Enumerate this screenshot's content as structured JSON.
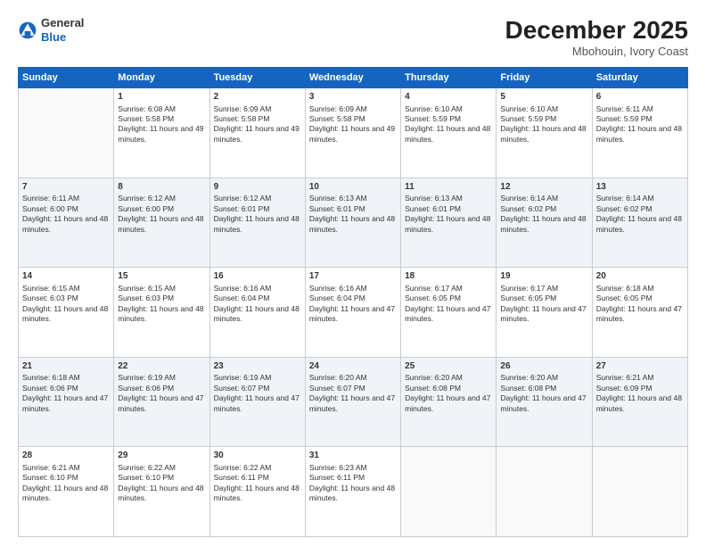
{
  "header": {
    "logo_general": "General",
    "logo_blue": "Blue",
    "month": "December 2025",
    "location": "Mbohouin, Ivory Coast"
  },
  "weekdays": [
    "Sunday",
    "Monday",
    "Tuesday",
    "Wednesday",
    "Thursday",
    "Friday",
    "Saturday"
  ],
  "weeks": [
    [
      {
        "day": "",
        "sunrise": "",
        "sunset": "",
        "daylight": ""
      },
      {
        "day": "1",
        "sunrise": "Sunrise: 6:08 AM",
        "sunset": "Sunset: 5:58 PM",
        "daylight": "Daylight: 11 hours and 49 minutes."
      },
      {
        "day": "2",
        "sunrise": "Sunrise: 6:09 AM",
        "sunset": "Sunset: 5:58 PM",
        "daylight": "Daylight: 11 hours and 49 minutes."
      },
      {
        "day": "3",
        "sunrise": "Sunrise: 6:09 AM",
        "sunset": "Sunset: 5:58 PM",
        "daylight": "Daylight: 11 hours and 49 minutes."
      },
      {
        "day": "4",
        "sunrise": "Sunrise: 6:10 AM",
        "sunset": "Sunset: 5:59 PM",
        "daylight": "Daylight: 11 hours and 48 minutes."
      },
      {
        "day": "5",
        "sunrise": "Sunrise: 6:10 AM",
        "sunset": "Sunset: 5:59 PM",
        "daylight": "Daylight: 11 hours and 48 minutes."
      },
      {
        "day": "6",
        "sunrise": "Sunrise: 6:11 AM",
        "sunset": "Sunset: 5:59 PM",
        "daylight": "Daylight: 11 hours and 48 minutes."
      }
    ],
    [
      {
        "day": "7",
        "sunrise": "Sunrise: 6:11 AM",
        "sunset": "Sunset: 6:00 PM",
        "daylight": "Daylight: 11 hours and 48 minutes."
      },
      {
        "day": "8",
        "sunrise": "Sunrise: 6:12 AM",
        "sunset": "Sunset: 6:00 PM",
        "daylight": "Daylight: 11 hours and 48 minutes."
      },
      {
        "day": "9",
        "sunrise": "Sunrise: 6:12 AM",
        "sunset": "Sunset: 6:01 PM",
        "daylight": "Daylight: 11 hours and 48 minutes."
      },
      {
        "day": "10",
        "sunrise": "Sunrise: 6:13 AM",
        "sunset": "Sunset: 6:01 PM",
        "daylight": "Daylight: 11 hours and 48 minutes."
      },
      {
        "day": "11",
        "sunrise": "Sunrise: 6:13 AM",
        "sunset": "Sunset: 6:01 PM",
        "daylight": "Daylight: 11 hours and 48 minutes."
      },
      {
        "day": "12",
        "sunrise": "Sunrise: 6:14 AM",
        "sunset": "Sunset: 6:02 PM",
        "daylight": "Daylight: 11 hours and 48 minutes."
      },
      {
        "day": "13",
        "sunrise": "Sunrise: 6:14 AM",
        "sunset": "Sunset: 6:02 PM",
        "daylight": "Daylight: 11 hours and 48 minutes."
      }
    ],
    [
      {
        "day": "14",
        "sunrise": "Sunrise: 6:15 AM",
        "sunset": "Sunset: 6:03 PM",
        "daylight": "Daylight: 11 hours and 48 minutes."
      },
      {
        "day": "15",
        "sunrise": "Sunrise: 6:15 AM",
        "sunset": "Sunset: 6:03 PM",
        "daylight": "Daylight: 11 hours and 48 minutes."
      },
      {
        "day": "16",
        "sunrise": "Sunrise: 6:16 AM",
        "sunset": "Sunset: 6:04 PM",
        "daylight": "Daylight: 11 hours and 48 minutes."
      },
      {
        "day": "17",
        "sunrise": "Sunrise: 6:16 AM",
        "sunset": "Sunset: 6:04 PM",
        "daylight": "Daylight: 11 hours and 47 minutes."
      },
      {
        "day": "18",
        "sunrise": "Sunrise: 6:17 AM",
        "sunset": "Sunset: 6:05 PM",
        "daylight": "Daylight: 11 hours and 47 minutes."
      },
      {
        "day": "19",
        "sunrise": "Sunrise: 6:17 AM",
        "sunset": "Sunset: 6:05 PM",
        "daylight": "Daylight: 11 hours and 47 minutes."
      },
      {
        "day": "20",
        "sunrise": "Sunrise: 6:18 AM",
        "sunset": "Sunset: 6:05 PM",
        "daylight": "Daylight: 11 hours and 47 minutes."
      }
    ],
    [
      {
        "day": "21",
        "sunrise": "Sunrise: 6:18 AM",
        "sunset": "Sunset: 6:06 PM",
        "daylight": "Daylight: 11 hours and 47 minutes."
      },
      {
        "day": "22",
        "sunrise": "Sunrise: 6:19 AM",
        "sunset": "Sunset: 6:06 PM",
        "daylight": "Daylight: 11 hours and 47 minutes."
      },
      {
        "day": "23",
        "sunrise": "Sunrise: 6:19 AM",
        "sunset": "Sunset: 6:07 PM",
        "daylight": "Daylight: 11 hours and 47 minutes."
      },
      {
        "day": "24",
        "sunrise": "Sunrise: 6:20 AM",
        "sunset": "Sunset: 6:07 PM",
        "daylight": "Daylight: 11 hours and 47 minutes."
      },
      {
        "day": "25",
        "sunrise": "Sunrise: 6:20 AM",
        "sunset": "Sunset: 6:08 PM",
        "daylight": "Daylight: 11 hours and 47 minutes."
      },
      {
        "day": "26",
        "sunrise": "Sunrise: 6:20 AM",
        "sunset": "Sunset: 6:08 PM",
        "daylight": "Daylight: 11 hours and 47 minutes."
      },
      {
        "day": "27",
        "sunrise": "Sunrise: 6:21 AM",
        "sunset": "Sunset: 6:09 PM",
        "daylight": "Daylight: 11 hours and 48 minutes."
      }
    ],
    [
      {
        "day": "28",
        "sunrise": "Sunrise: 6:21 AM",
        "sunset": "Sunset: 6:10 PM",
        "daylight": "Daylight: 11 hours and 48 minutes."
      },
      {
        "day": "29",
        "sunrise": "Sunrise: 6:22 AM",
        "sunset": "Sunset: 6:10 PM",
        "daylight": "Daylight: 11 hours and 48 minutes."
      },
      {
        "day": "30",
        "sunrise": "Sunrise: 6:22 AM",
        "sunset": "Sunset: 6:11 PM",
        "daylight": "Daylight: 11 hours and 48 minutes."
      },
      {
        "day": "31",
        "sunrise": "Sunrise: 6:23 AM",
        "sunset": "Sunset: 6:11 PM",
        "daylight": "Daylight: 11 hours and 48 minutes."
      },
      {
        "day": "",
        "sunrise": "",
        "sunset": "",
        "daylight": ""
      },
      {
        "day": "",
        "sunrise": "",
        "sunset": "",
        "daylight": ""
      },
      {
        "day": "",
        "sunrise": "",
        "sunset": "",
        "daylight": ""
      }
    ]
  ]
}
